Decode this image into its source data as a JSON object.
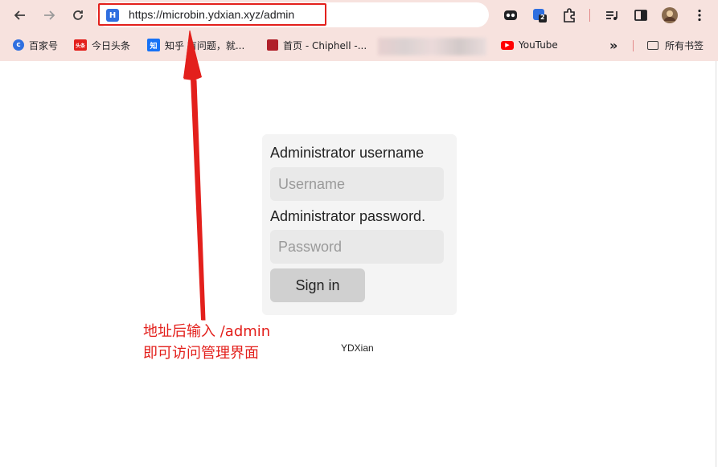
{
  "browser": {
    "url": "https://microbin.ydxian.xyz/admin",
    "site_icon_letter": "H",
    "extension_badge": "2",
    "bookmarks": [
      {
        "label": "百家号",
        "icon": "baijiahao-icon",
        "color": "#2f6fe0"
      },
      {
        "label": "今日头条",
        "icon": "toutiao-icon",
        "color": "#e3201c",
        "icon_text": "头条"
      },
      {
        "label": "知乎 有问题，就...",
        "icon": "zhihu-icon",
        "color": "#1772f6",
        "icon_text": "知"
      },
      {
        "label": "首页 - Chiphell -...",
        "icon": "chiphell-icon",
        "color": "#b0202a"
      },
      {
        "label": "YouTube",
        "icon": "youtube-icon",
        "color": "#ff0000"
      }
    ],
    "more_label": "»",
    "all_bookmarks_label": "所有书签"
  },
  "login": {
    "username_label": "Administrator username",
    "username_placeholder": "Username",
    "password_label": "Administrator password.",
    "password_placeholder": "Password",
    "signin_label": "Sign in"
  },
  "footer": {
    "text": "YDXian"
  },
  "annotation": {
    "line1": "地址后输入 /admin",
    "line2": "即可访问管理界面",
    "color": "#e3201c"
  }
}
